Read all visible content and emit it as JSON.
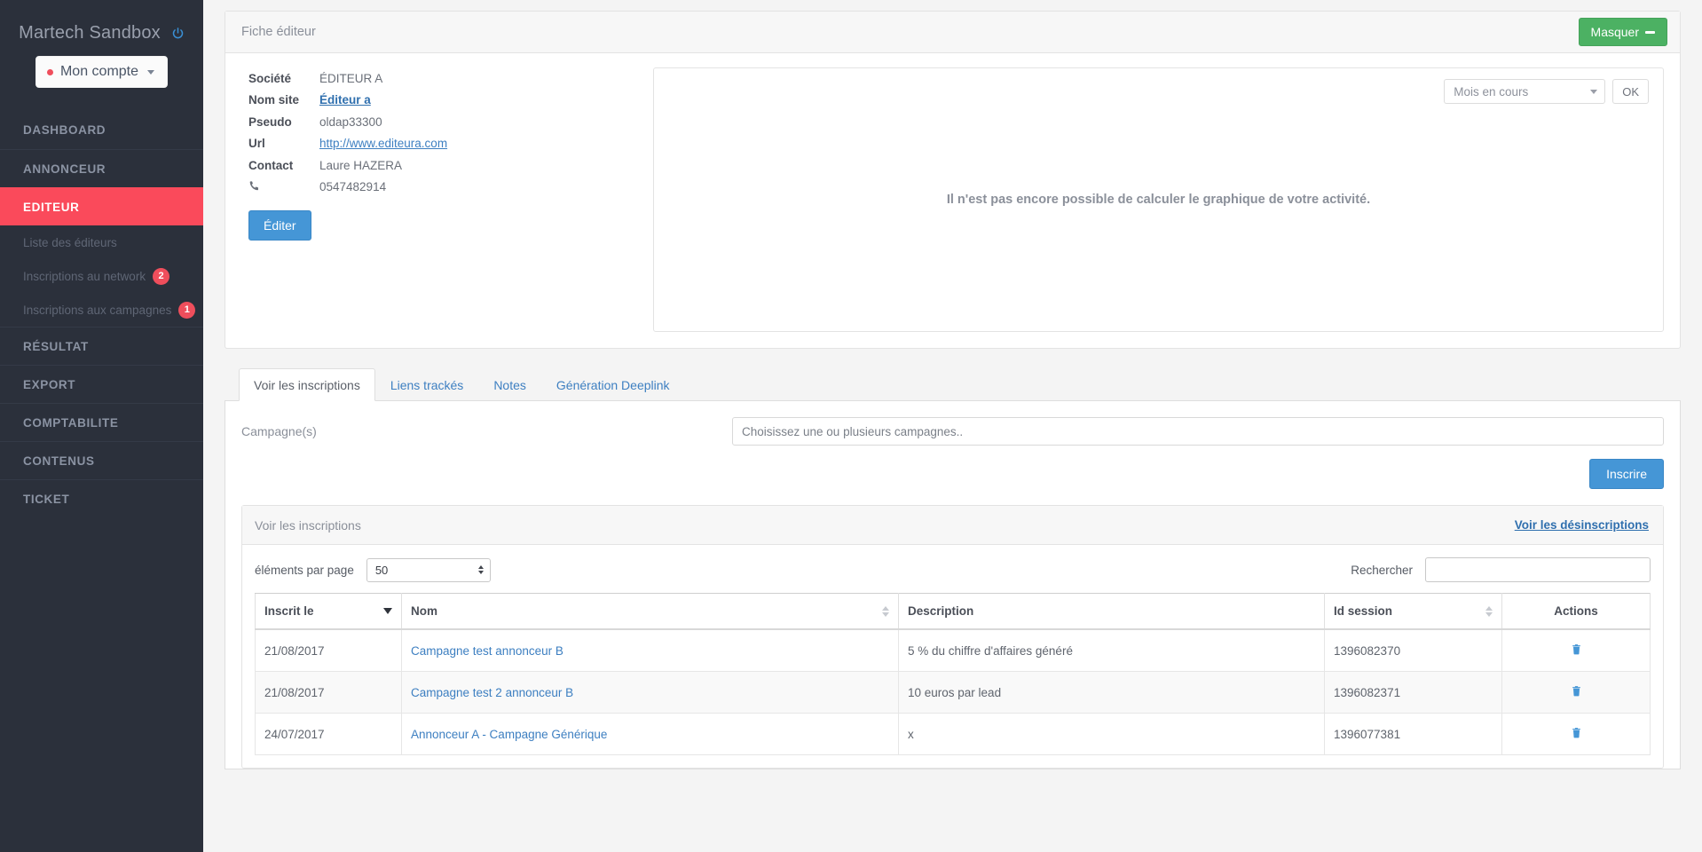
{
  "sidebar": {
    "brand": "Martech Sandbox",
    "power_icon": "power-icon",
    "account_button": "Mon compte",
    "nav": [
      {
        "label": "DASHBOARD",
        "active": false
      },
      {
        "label": "ANNONCEUR",
        "active": false
      },
      {
        "label": "EDITEUR",
        "active": true
      },
      {
        "label": "RÉSULTAT",
        "active": false
      },
      {
        "label": "EXPORT",
        "active": false
      },
      {
        "label": "COMPTABILITE",
        "active": false
      },
      {
        "label": "CONTENUS",
        "active": false
      },
      {
        "label": "TICKET",
        "active": false
      }
    ],
    "sub_items": [
      {
        "label": "Liste des éditeurs",
        "badge": ""
      },
      {
        "label": "Inscriptions au network",
        "badge": "2"
      },
      {
        "label": "Inscriptions aux campagnes",
        "badge": "1"
      }
    ]
  },
  "fiche": {
    "panel_title": "Fiche éditeur",
    "hide_button": "Masquer",
    "fields": [
      {
        "label": "Société",
        "value": "ÉDITEUR A",
        "style": "plain"
      },
      {
        "label": "Nom site",
        "value": "Éditeur a",
        "style": "bold-link"
      },
      {
        "label": "Pseudo",
        "value": "oldap33300",
        "style": "plain"
      },
      {
        "label": "Url",
        "value": "http://www.editeura.com",
        "style": "link"
      },
      {
        "label": "Contact",
        "value": "Laure HAZERA",
        "style": "plain"
      },
      {
        "label": "phone-icon",
        "value": "0547482914",
        "style": "plain"
      }
    ],
    "edit_button": "Éditer"
  },
  "chart": {
    "period_selected": "Mois en cours",
    "ok_button": "OK",
    "message": "Il n'est pas encore possible de calculer le graphique de votre activité."
  },
  "tabs": [
    {
      "label": "Voir les inscriptions",
      "active": true
    },
    {
      "label": "Liens trackés",
      "active": false
    },
    {
      "label": "Notes",
      "active": false
    },
    {
      "label": "Génération Deeplink",
      "active": false
    }
  ],
  "campaign_form": {
    "label": "Campagne(s)",
    "input_value": "",
    "input_placeholder": "Choisissez une ou plusieurs campagnes..",
    "submit_button": "Inscrire"
  },
  "inscriptions_panel": {
    "title": "Voir les inscriptions",
    "link": "Voir les désinscriptions",
    "per_page_label": "éléments par page",
    "per_page_value": "50",
    "search_label": "Rechercher",
    "search_value": "",
    "columns": [
      {
        "label": "Inscrit le",
        "sort": "desc"
      },
      {
        "label": "Nom",
        "sort": "both"
      },
      {
        "label": "Description",
        "sort": "none"
      },
      {
        "label": "Id session",
        "sort": "both"
      },
      {
        "label": "Actions",
        "sort": "none"
      }
    ],
    "rows": [
      {
        "date": "21/08/2017",
        "name": "Campagne test annonceur B",
        "description": "5 % du chiffre d'affaires généré",
        "session_id": "1396082370",
        "action_icon": "trash-icon"
      },
      {
        "date": "21/08/2017",
        "name": "Campagne test 2 annonceur B",
        "description": "10 euros par lead",
        "session_id": "1396082371",
        "action_icon": "trash-icon"
      },
      {
        "date": "24/07/2017",
        "name": "Annonceur A - Campagne Générique",
        "description": "x",
        "session_id": "1396077381",
        "action_icon": "trash-icon"
      }
    ]
  },
  "colors": {
    "sidebar_bg": "#2b303b",
    "accent_red": "#fa4a5b",
    "badge_red": "#ef4e5c",
    "link_blue": "#3d7fc1",
    "button_blue": "#4596d6",
    "button_green": "#4cb163"
  }
}
